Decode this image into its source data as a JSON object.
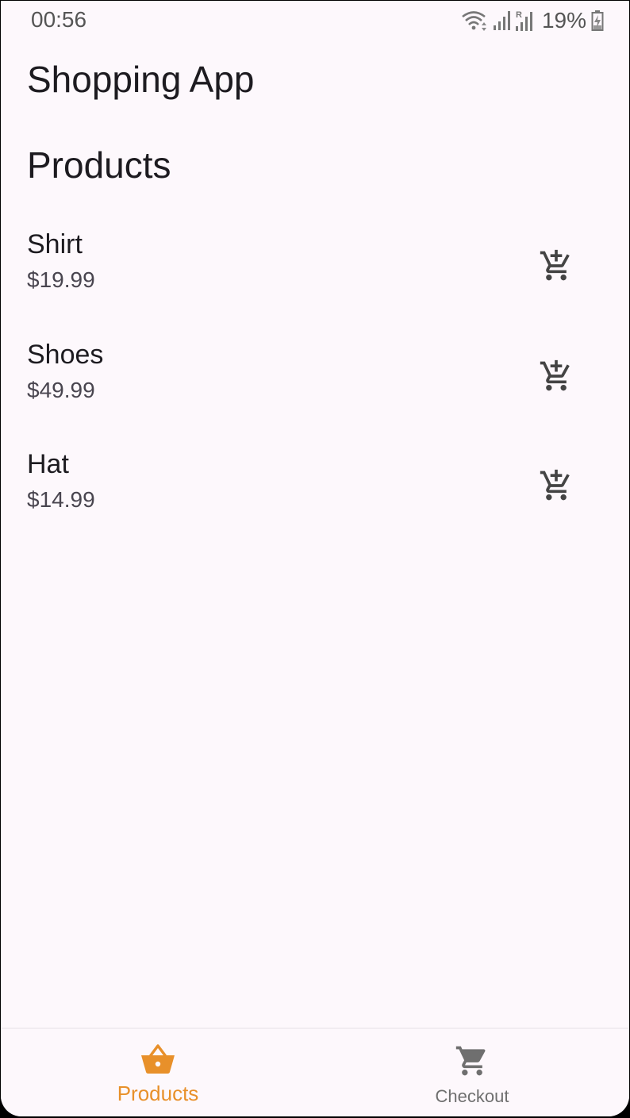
{
  "status_bar": {
    "time": "00:56",
    "battery": "19%",
    "icons": [
      "wifi-icon",
      "signal-icon",
      "signal-roaming-icon",
      "battery-charging-icon"
    ]
  },
  "app_bar": {
    "title": "Shopping App"
  },
  "main": {
    "section_title": "Products",
    "products": [
      {
        "name": "Shirt",
        "price": "$19.99",
        "action_icon": "add-shopping-cart-icon"
      },
      {
        "name": "Shoes",
        "price": "$49.99",
        "action_icon": "add-shopping-cart-icon"
      },
      {
        "name": "Hat",
        "price": "$14.99",
        "action_icon": "add-shopping-cart-icon"
      }
    ]
  },
  "bottom_nav": {
    "items": [
      {
        "label": "Products",
        "icon": "shopping-basket-icon",
        "selected": true
      },
      {
        "label": "Checkout",
        "icon": "shopping-cart-icon",
        "selected": false
      }
    ]
  },
  "colors": {
    "accent": "#e8902a",
    "background": "#fdf8fc",
    "text_primary": "#1d1b20",
    "icon": "#444444",
    "nav_inactive": "#6f6f6f"
  }
}
